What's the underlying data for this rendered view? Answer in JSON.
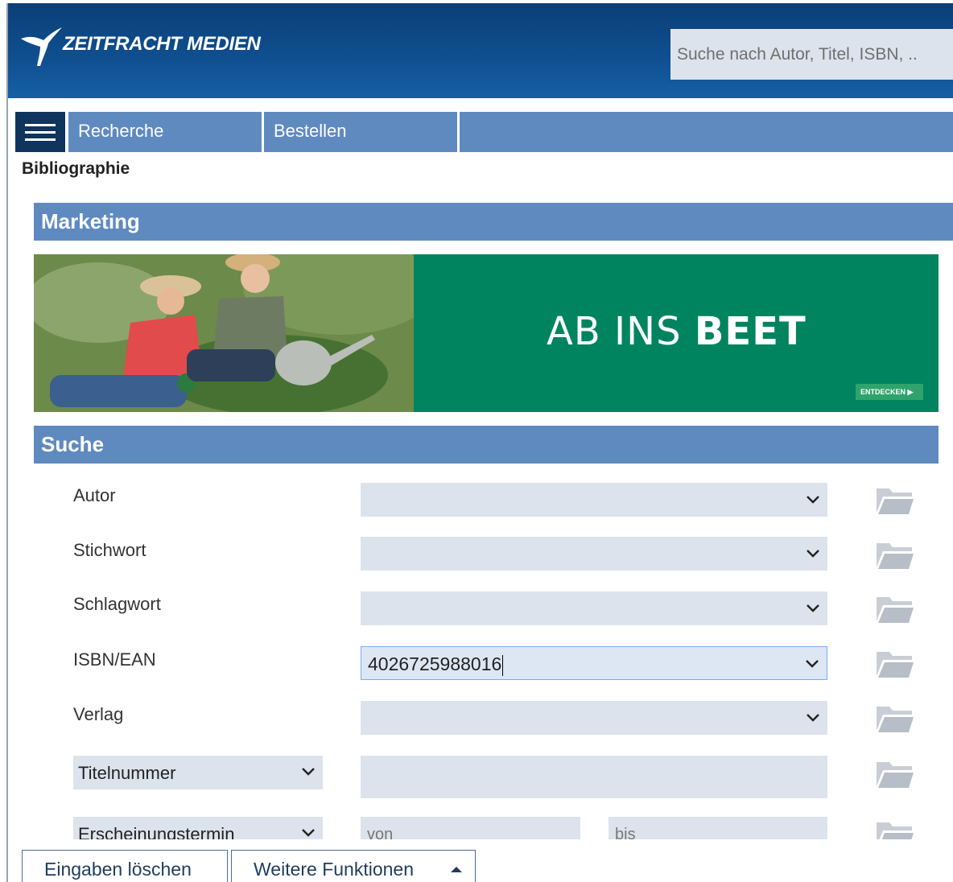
{
  "header": {
    "logo_text": "ZEITFRACHT MEDIEN",
    "search_placeholder": "Suche nach Autor, Titel, ISBN, .."
  },
  "nav": {
    "tabs": [
      {
        "label": "Recherche"
      },
      {
        "label": "Bestellen"
      }
    ]
  },
  "page": {
    "title": "Bibliographie"
  },
  "marketing": {
    "title": "Marketing",
    "banner_headline_light": "AB INS ",
    "banner_headline_bold": "BEET",
    "banner_cta": "ENTDECKEN ▶"
  },
  "search": {
    "title": "Suche",
    "fields": [
      {
        "label": "Autor",
        "value": ""
      },
      {
        "label": "Stichwort",
        "value": ""
      },
      {
        "label": "Schlagwort",
        "value": ""
      },
      {
        "label": "ISBN/EAN",
        "value": "4026725988016"
      },
      {
        "label": "Verlag",
        "value": ""
      }
    ],
    "titelnummer_select": "Titelnummer",
    "termin_select": "Erscheinungstermin",
    "von_placeholder": "von",
    "bis_placeholder": "bis"
  },
  "footer": {
    "clear_label": "Eingaben löschen",
    "more_label": "Weitere Funktionen"
  },
  "colors": {
    "header_blue": "#0f4e8e",
    "nav_blue": "#5f8ac0",
    "nav_dark": "#0f355e",
    "banner_green": "#00845f",
    "input_bg": "#dde3ec"
  }
}
